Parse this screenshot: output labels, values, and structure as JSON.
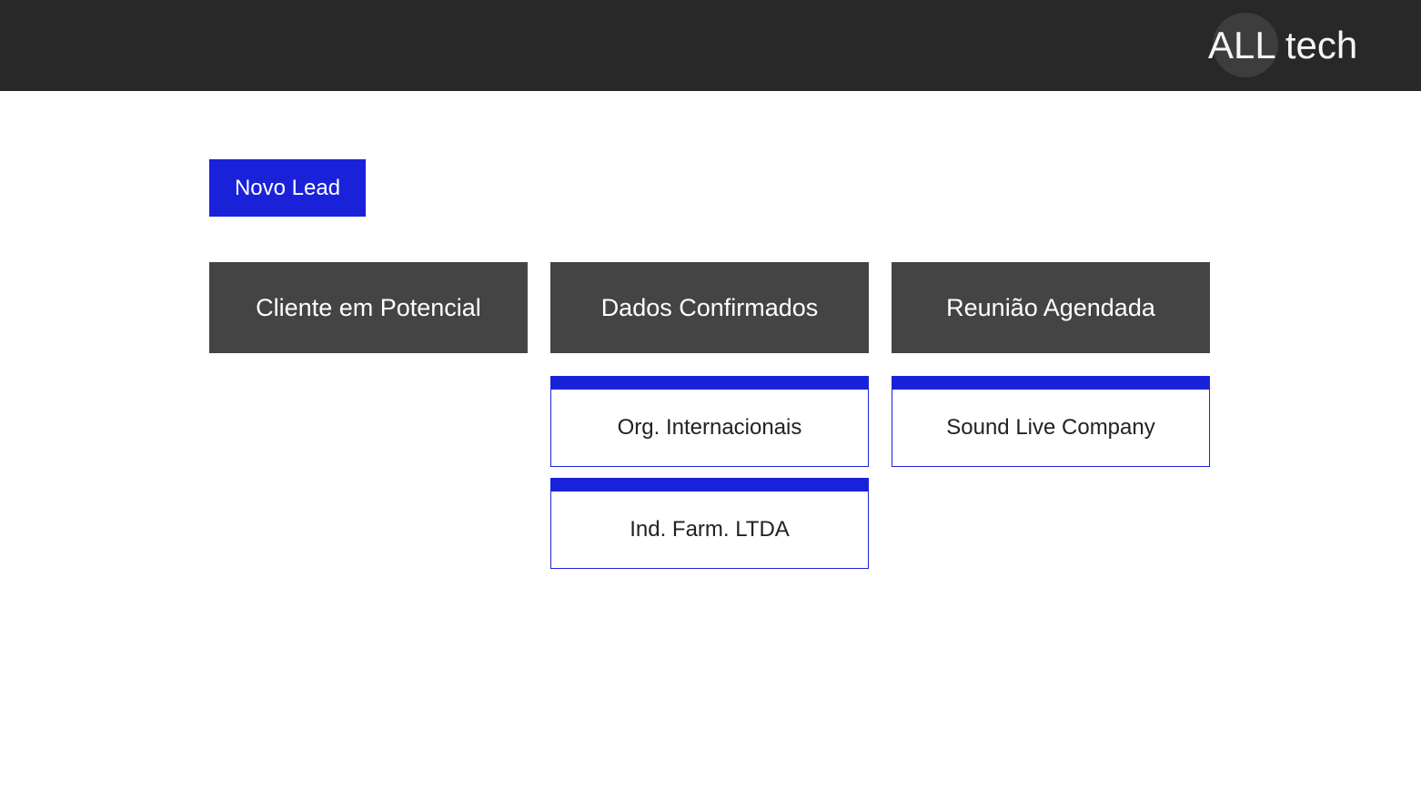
{
  "header": {
    "logo_text": "ALL tech"
  },
  "toolbar": {
    "new_lead_label": "Novo Lead"
  },
  "board": {
    "columns": [
      {
        "title": "Cliente em Potencial",
        "cards": []
      },
      {
        "title": "Dados Confirmados",
        "cards": [
          "Org. Internacionais",
          "Ind. Farm. LTDA"
        ]
      },
      {
        "title": "Reunião Agendada",
        "cards": [
          "Sound Live Company"
        ]
      }
    ]
  },
  "colors": {
    "topbar": "#282828",
    "accent": "#1a22d9",
    "column_header": "#444444"
  }
}
